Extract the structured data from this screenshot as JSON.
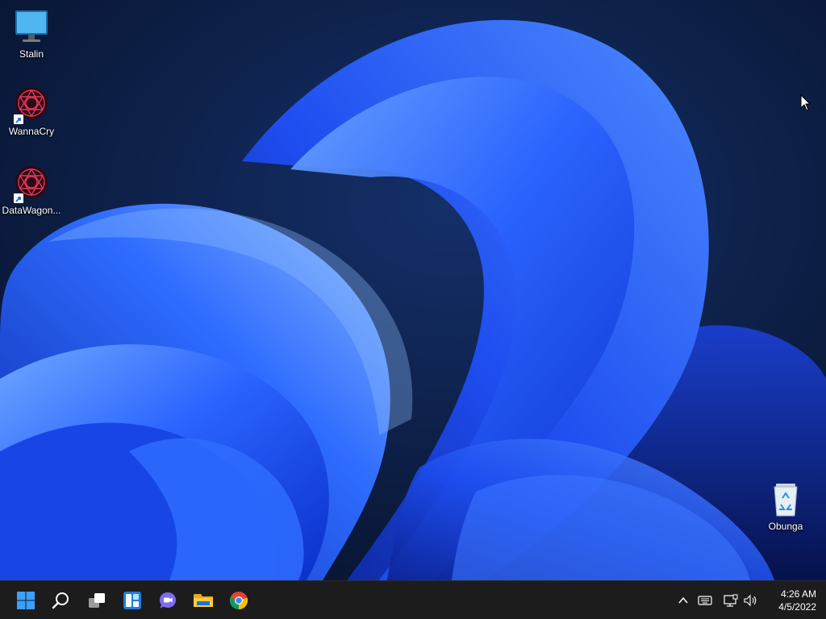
{
  "desktop": {
    "icons": [
      {
        "label": "Stalin",
        "icon": "monitor-icon"
      },
      {
        "label": "WannaCry",
        "icon": "malware-app-icon"
      },
      {
        "label": "DataWagon...",
        "icon": "malware-app-icon"
      },
      {
        "label": "Obunga",
        "icon": "recycle-bin-icon"
      }
    ]
  },
  "taskbar": {
    "pinned": [
      {
        "name": "Start",
        "icon": "windows-logo-icon"
      },
      {
        "name": "Search",
        "icon": "search-icon"
      },
      {
        "name": "Task View",
        "icon": "task-view-icon"
      },
      {
        "name": "Widgets",
        "icon": "widgets-icon"
      },
      {
        "name": "Chat",
        "icon": "chat-icon"
      },
      {
        "name": "File Explorer",
        "icon": "folder-icon"
      },
      {
        "name": "Google Chrome",
        "icon": "chrome-icon"
      }
    ],
    "tray": {
      "icons": [
        "chevron-up-icon",
        "keyboard-icon",
        "network-icon",
        "volume-icon"
      ],
      "time": "4:26 AM",
      "date": "4/5/2022"
    }
  },
  "colors": {
    "wallpaper_dark": "#0b1a3a",
    "wallpaper_bloom": "#1f5bff",
    "taskbar_bg": "#1c1c1c",
    "windows_logo": "#3aa0ff"
  }
}
